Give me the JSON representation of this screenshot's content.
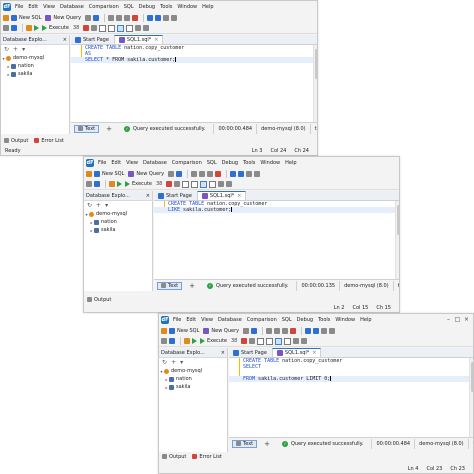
{
  "menu": [
    "File",
    "Edit",
    "View",
    "Database",
    "Comparison",
    "SQL",
    "Debug",
    "Tools",
    "Window",
    "Help"
  ],
  "toolbar": {
    "new_sql": "New SQL",
    "new_query": "New Query",
    "execute": "Execute",
    "execute_count": "38"
  },
  "panel": {
    "title": "Database Explo...",
    "connection": "demo-mysql",
    "databases": [
      "nation",
      "sakila"
    ]
  },
  "tabs": {
    "start_page": "Start Page",
    "sql_tab": "SQL1.sql*"
  },
  "results": {
    "text_tab": "Text",
    "status": "Query executed successfully.",
    "tz": "tx"
  },
  "bottom": {
    "output": "Output",
    "error_list": "Error List"
  },
  "windows": [
    {
      "code": [
        {
          "kw": "CREATE TABLE",
          "rest": " nation.copy_customer"
        },
        {
          "kw": "AS",
          "rest": ""
        },
        {
          "kw": "SELECT",
          "rest": " * FROM sakila.customer;"
        }
      ],
      "time": "00:00:00.484",
      "connection": "demo-mysql (8.0)",
      "db": "sakila",
      "status": "Ready",
      "ln": "Ln 3",
      "col": "Col 24",
      "ch": "Ch 24"
    },
    {
      "code": [
        {
          "kw": "CREATE TABLE",
          "rest": " nation.copy_customer"
        },
        {
          "kw": "LIKE",
          "rest": " sakila.customer;"
        }
      ],
      "time": "00:00:00.135",
      "connection": "demo-mysql (8.0)",
      "db": "sakila",
      "status": "",
      "ln": "Ln 2",
      "col": "Col 15",
      "ch": "Ch 15"
    },
    {
      "code": [
        {
          "kw": "CREATE TABLE",
          "rest": " nation.copy_customer"
        },
        {
          "kw": "SELECT",
          "rest": ""
        },
        {
          "kw": "",
          "rest": ""
        },
        {
          "kw": "FROM",
          "rest": " sakila.customer LIMIT 0;"
        }
      ],
      "time": "00:00:00.484",
      "connection": "demo-mysql (8.0)",
      "db": "sakila",
      "status": "",
      "ln": "Ln 4",
      "col": "Col 23",
      "ch": "Ch 23"
    }
  ]
}
